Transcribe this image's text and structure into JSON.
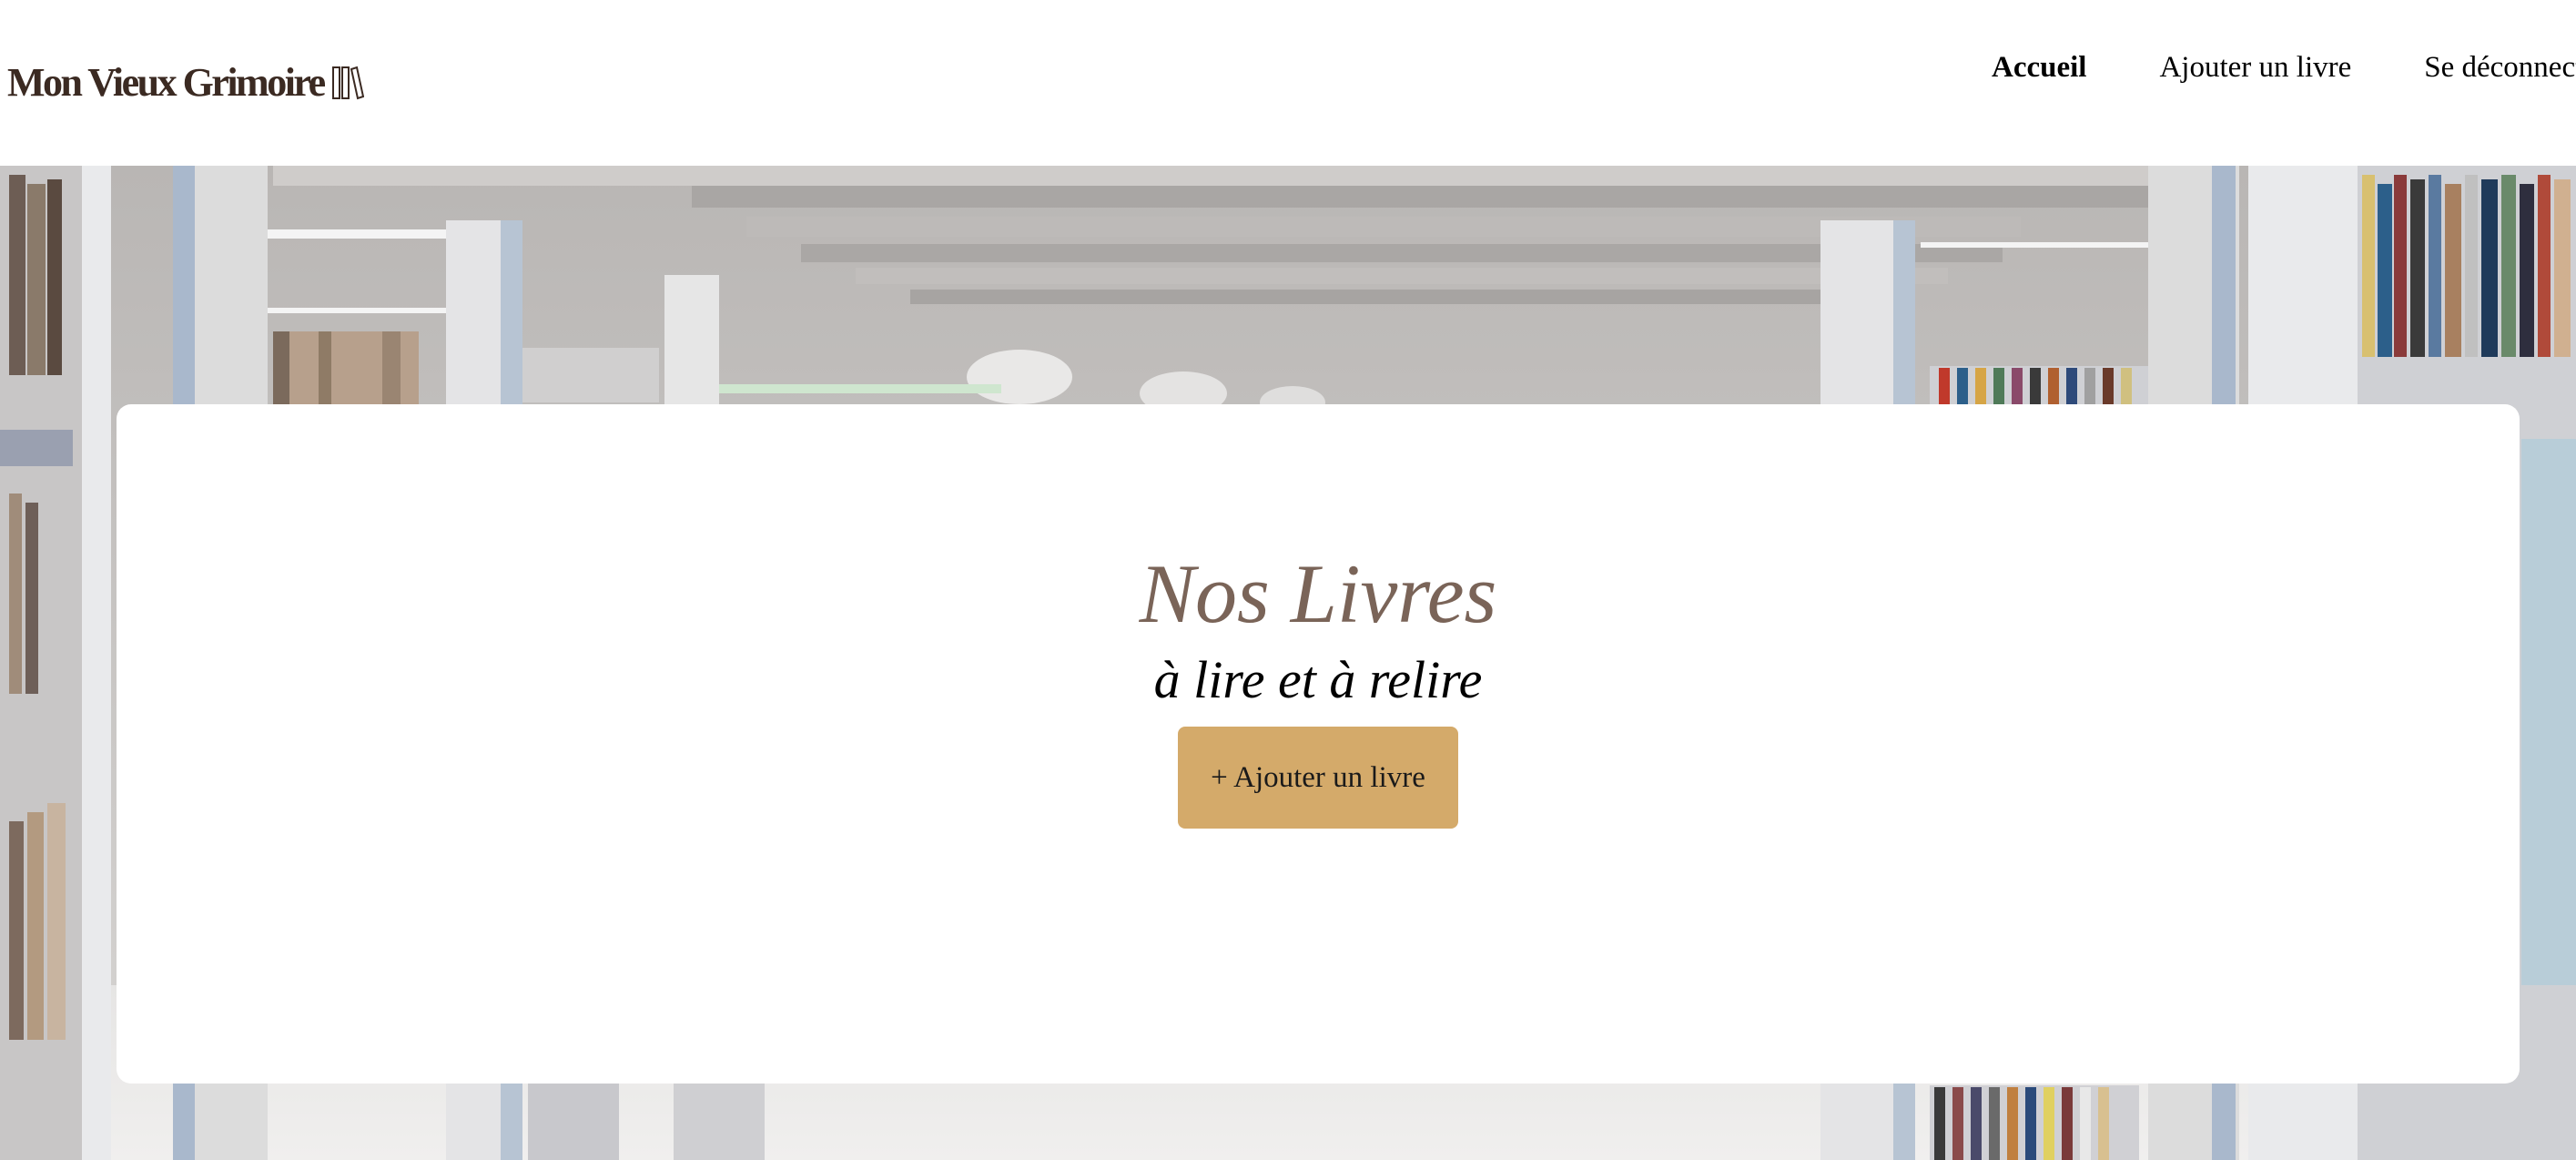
{
  "header": {
    "logo_text": "Mon Vieux Grimoire",
    "logo_icon": "books-icon",
    "nav": {
      "home": "Accueil",
      "add_book": "Ajouter un livre",
      "logout": "Se déconnecter"
    }
  },
  "hero": {
    "title": "Nos Livres",
    "subtitle": "à lire et à relire",
    "button_label": "+ Ajouter un livre"
  },
  "colors": {
    "title": "#7a6458",
    "logo": "#3b2a22",
    "button": "#d4aa6a"
  }
}
